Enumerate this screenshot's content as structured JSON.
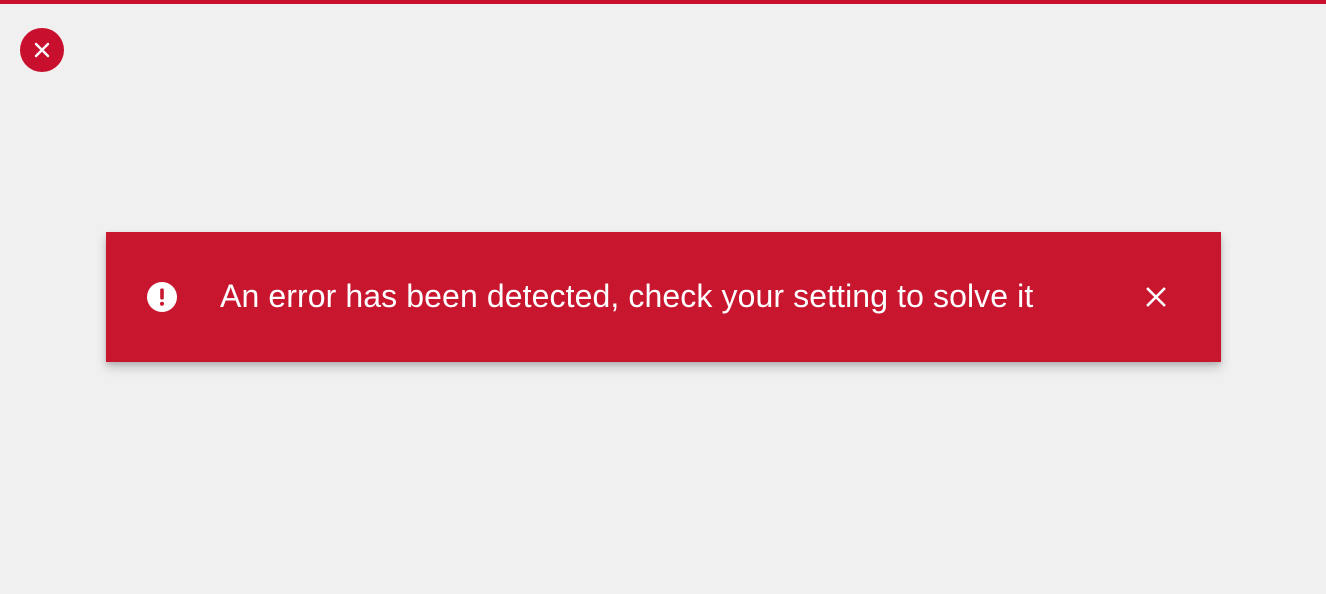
{
  "colors": {
    "background": "#f0f0f0",
    "accent": "#c8102e",
    "toast_background": "#c8162f",
    "toast_text": "#ffffff"
  },
  "top_bar": {
    "icon": "none"
  },
  "corner_close": {
    "icon": "close-icon"
  },
  "toast": {
    "status_icon": "exclamation-circle-icon",
    "message": "An error has been detected, check your setting to solve it",
    "close_icon": "close-icon"
  }
}
